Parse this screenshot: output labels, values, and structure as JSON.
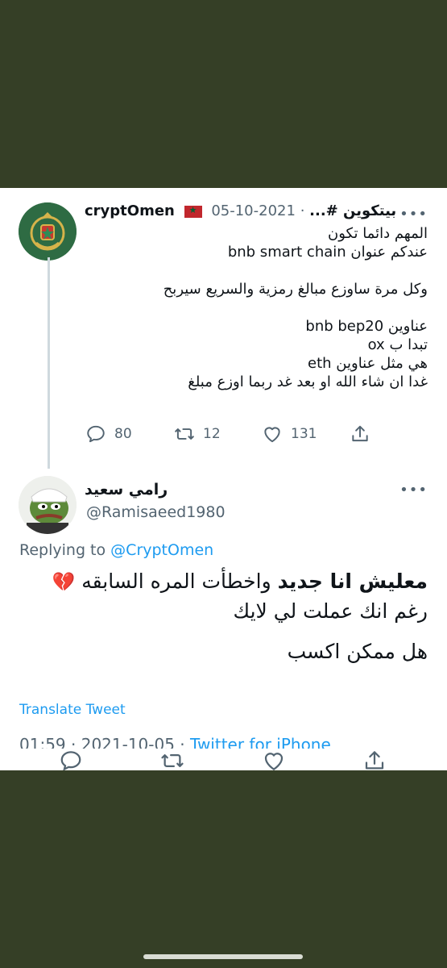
{
  "quoted_tweet": {
    "author_name": "cryptOmen",
    "author_hashtag": "بيتكوين #...",
    "separator": "·",
    "date": "2021-10-05",
    "more": "•••",
    "lines": [
      "المهم دائما تكون",
      "عندكم عنوان bnb smart chain",
      "",
      "وكل مرة ساوزع مبالغ رمزية والسريع سيربح",
      "",
      "عناوين bnb bep20",
      "تبدا ب ox",
      "هي مثل عناوين eth",
      "غدا ان شاء الله او بعد غد ربما اوزع مبلغ"
    ],
    "replies": "80",
    "retweets": "12",
    "likes": "131"
  },
  "reply_tweet": {
    "author_name": "رامي سعيد",
    "handle": "@Ramisaeed1980",
    "more": "•••",
    "replying_prefix": "Replying to",
    "replying_to": "@CryptOmen",
    "line1_bold": "معليش انا جديد",
    "line1_rest": " واخطأت المره السابقه ",
    "line1_emoji": "💔",
    "line2": "رغم انك عملت لي لايك",
    "line3": "هل ممكن اكسب",
    "translate": "Translate Tweet",
    "time": "01:59",
    "meta_sep": " · ",
    "date": "2021-10-05",
    "source": "Twitter for iPhone"
  },
  "icons": {
    "reply": "reply-icon",
    "retweet": "retweet-icon",
    "like": "heart-icon",
    "share": "share-icon"
  },
  "colors": {
    "background": "#353f26",
    "link": "#1d9bf0",
    "muted": "#536471"
  }
}
